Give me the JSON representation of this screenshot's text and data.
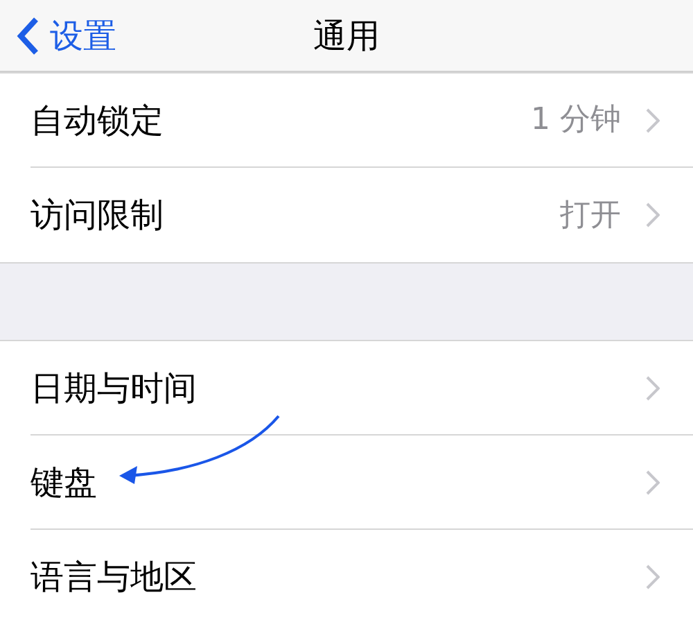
{
  "nav_bar": {
    "back": "设置",
    "title": "通用"
  },
  "sections": [
    {
      "rows": [
        {
          "label": "自动锁定",
          "value": "1 分钟"
        },
        {
          "label": "访问限制",
          "value": "打开"
        }
      ]
    },
    {
      "rows": [
        {
          "label": "日期与时间"
        },
        {
          "label": "键盘"
        },
        {
          "label": "语言与地区"
        }
      ]
    }
  ]
}
